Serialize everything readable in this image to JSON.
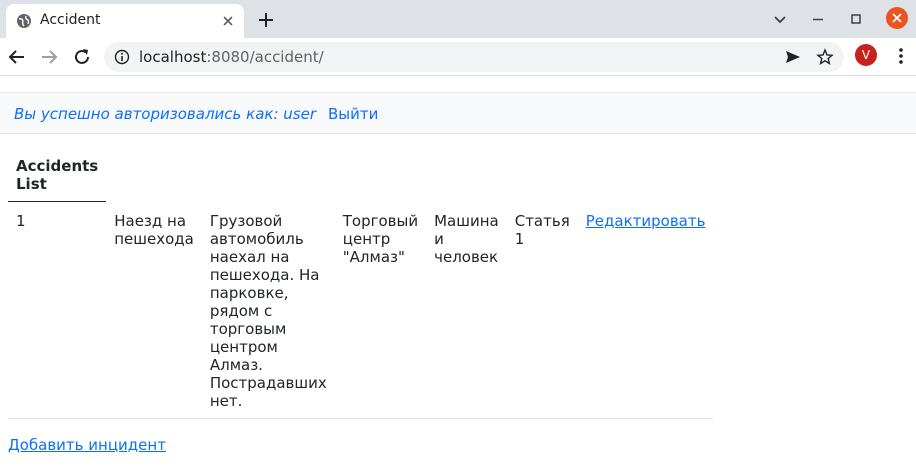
{
  "browser": {
    "tab_title": "Accident",
    "url_host": "localhost",
    "url_rest": ":8080/accident/",
    "avatar_letter": "V",
    "accent": "#e95420"
  },
  "auth": {
    "status_text": "Вы успешно авторизовались как: user",
    "logout_label": "Выйти"
  },
  "table": {
    "header": "Accidents List",
    "rows": [
      {
        "id": "1",
        "name": "Наезд на пешехода",
        "text": "Грузовой автомобиль наехал на пешехода. На парковке, рядом с торговым центром Алмаз. Пострадавших нет.",
        "address": "Торговый центр \"Алмаз\"",
        "type": "Машина и человек",
        "rule": "Статья 1",
        "edit_label": "Редактировать"
      }
    ]
  },
  "add_link": "Добавить инцидент",
  "icons": {
    "favicon": "globe-icon",
    "tab_close": "close-icon",
    "new_tab": "plus-icon",
    "back": "back-arrow-icon",
    "forward": "forward-arrow-icon",
    "reload": "reload-icon",
    "site_info": "info-icon",
    "send": "send-icon",
    "bookmark": "star-icon",
    "menu": "kebab-menu-icon"
  }
}
